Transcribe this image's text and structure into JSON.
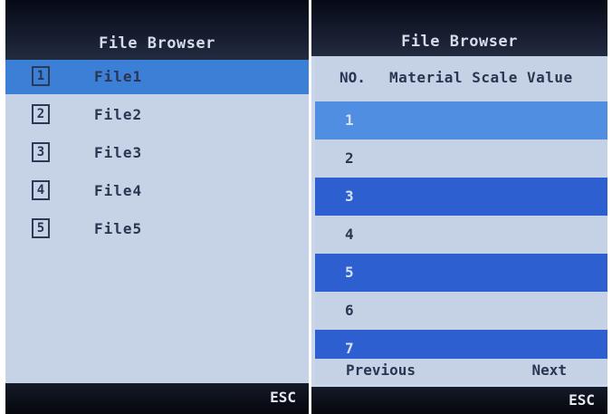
{
  "left_screen": {
    "title": "File Browser",
    "files": [
      {
        "number": "1",
        "name": "File1",
        "selected": true
      },
      {
        "number": "2",
        "name": "File2",
        "selected": false
      },
      {
        "number": "3",
        "name": "File3",
        "selected": false
      },
      {
        "number": "4",
        "name": "File4",
        "selected": false
      },
      {
        "number": "5",
        "name": "File5",
        "selected": false
      }
    ],
    "esc_label": "ESC"
  },
  "right_screen": {
    "title": "File Browser",
    "columns": [
      "NO.",
      "Material Scale Value"
    ],
    "rows": [
      {
        "no": "1",
        "style": "mid"
      },
      {
        "no": "2",
        "style": "light"
      },
      {
        "no": "3",
        "style": "dark"
      },
      {
        "no": "4",
        "style": "light"
      },
      {
        "no": "5",
        "style": "dark"
      },
      {
        "no": "6",
        "style": "light"
      },
      {
        "no": "7",
        "style": "dark"
      }
    ],
    "previous_label": "Previous",
    "next_label": "Next",
    "esc_label": "ESC"
  },
  "colors": {
    "selected": "#3b7fd6",
    "row_light": "#c5d2e6",
    "row_mid": "#4f8ee0",
    "row_dark": "#2d5fd0",
    "text": "#2a3552",
    "titlebar": "#161c2c"
  }
}
